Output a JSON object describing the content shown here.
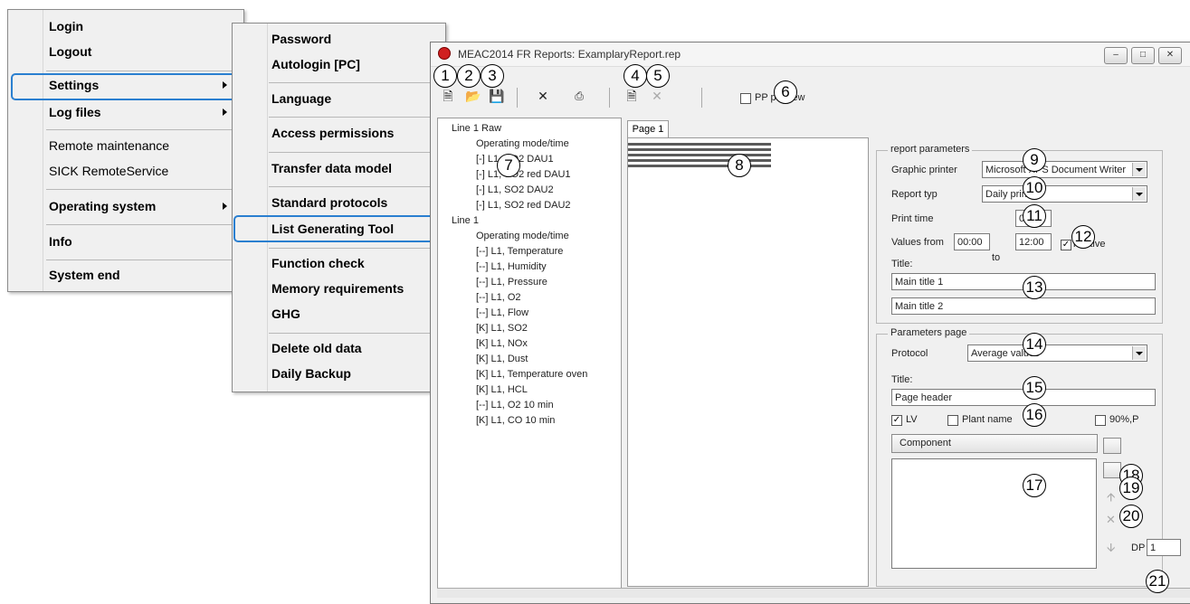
{
  "main_menu": {
    "items": [
      "Login",
      "Logout",
      "Settings",
      "Log files",
      "Remote maintenance",
      "SICK RemoteService",
      "Operating system",
      "Info",
      "System end"
    ]
  },
  "settings_submenu": {
    "items": [
      "Password",
      "Autologin [PC]",
      "Language",
      "Access permissions",
      "Transfer data model",
      "Standard protocols",
      "List Generating Tool",
      "Function check",
      "Memory requirements",
      "GHG",
      "Delete old data",
      "Daily Backup"
    ]
  },
  "window": {
    "title": "MEAC2014 FR Reports: ExamplaryReport.rep",
    "controls": [
      "minimize",
      "maximize",
      "close"
    ]
  },
  "toolbar": {
    "icons": [
      "new-icon",
      "open-icon",
      "save-icon",
      "delete-icon",
      "print-icon",
      "new-page-icon",
      "delete-page-icon"
    ],
    "pp_preview_label": "PP preview",
    "pp_preview_checked": false
  },
  "tree": {
    "items": [
      "Line 1 Raw",
      "Operating mode/time",
      "[-] L1, SO2 DAU1",
      "[-] L1, SO2 red DAU1",
      "[-] L1, SO2 DAU2",
      "[-] L1, SO2 red DAU2",
      "Line 1",
      "Operating mode/time",
      "[--] L1, Temperature",
      "[--] L1, Humidity",
      "[--] L1, Pressure",
      "[--] L1, O2",
      "[--] L1, Flow",
      "[K] L1, SO2",
      "[K] L1, NOx",
      "[K] L1, Dust",
      "[K] L1, Temperature oven",
      "[K] L1, HCL",
      "[--] L1, O2 10 min",
      "[K] L1, CO 10 min"
    ]
  },
  "page_tab": "Page 1",
  "report_parameters": {
    "group_label": "report parameters",
    "graphic_printer_label": "Graphic printer",
    "graphic_printer_value": "Microsoft XPS Document Writer",
    "report_type_label": "Report typ",
    "report_type_value": "Daily print",
    "print_time_label": "Print time",
    "print_time_value": "00:00",
    "values_from_label": "Values from",
    "values_from": "00:00",
    "to_label": "to",
    "values_to": "12:00",
    "relative_label": "relative",
    "relative_checked": true,
    "title_label": "Title:",
    "title_1": "Main title 1",
    "title_2": "Main title 2"
  },
  "parameters_page": {
    "group_label": "Parameters page",
    "protocol_label": "Protocol",
    "protocol_value": "Average values",
    "title_label": "Title:",
    "title_value": "Page header",
    "lv_label": "LV",
    "lv_checked": true,
    "plant_name_label": "Plant name",
    "plant_name_checked": false,
    "p90_label": "90%,P",
    "p90_checked": false,
    "component_header": "Component",
    "dp_label": "DP",
    "dp_value": "1"
  },
  "callouts": [
    "1",
    "2",
    "3",
    "4",
    "5",
    "6",
    "7",
    "8",
    "9",
    "10",
    "11",
    "12",
    "13",
    "14",
    "15",
    "16",
    "17",
    "18",
    "19",
    "20",
    "21"
  ]
}
